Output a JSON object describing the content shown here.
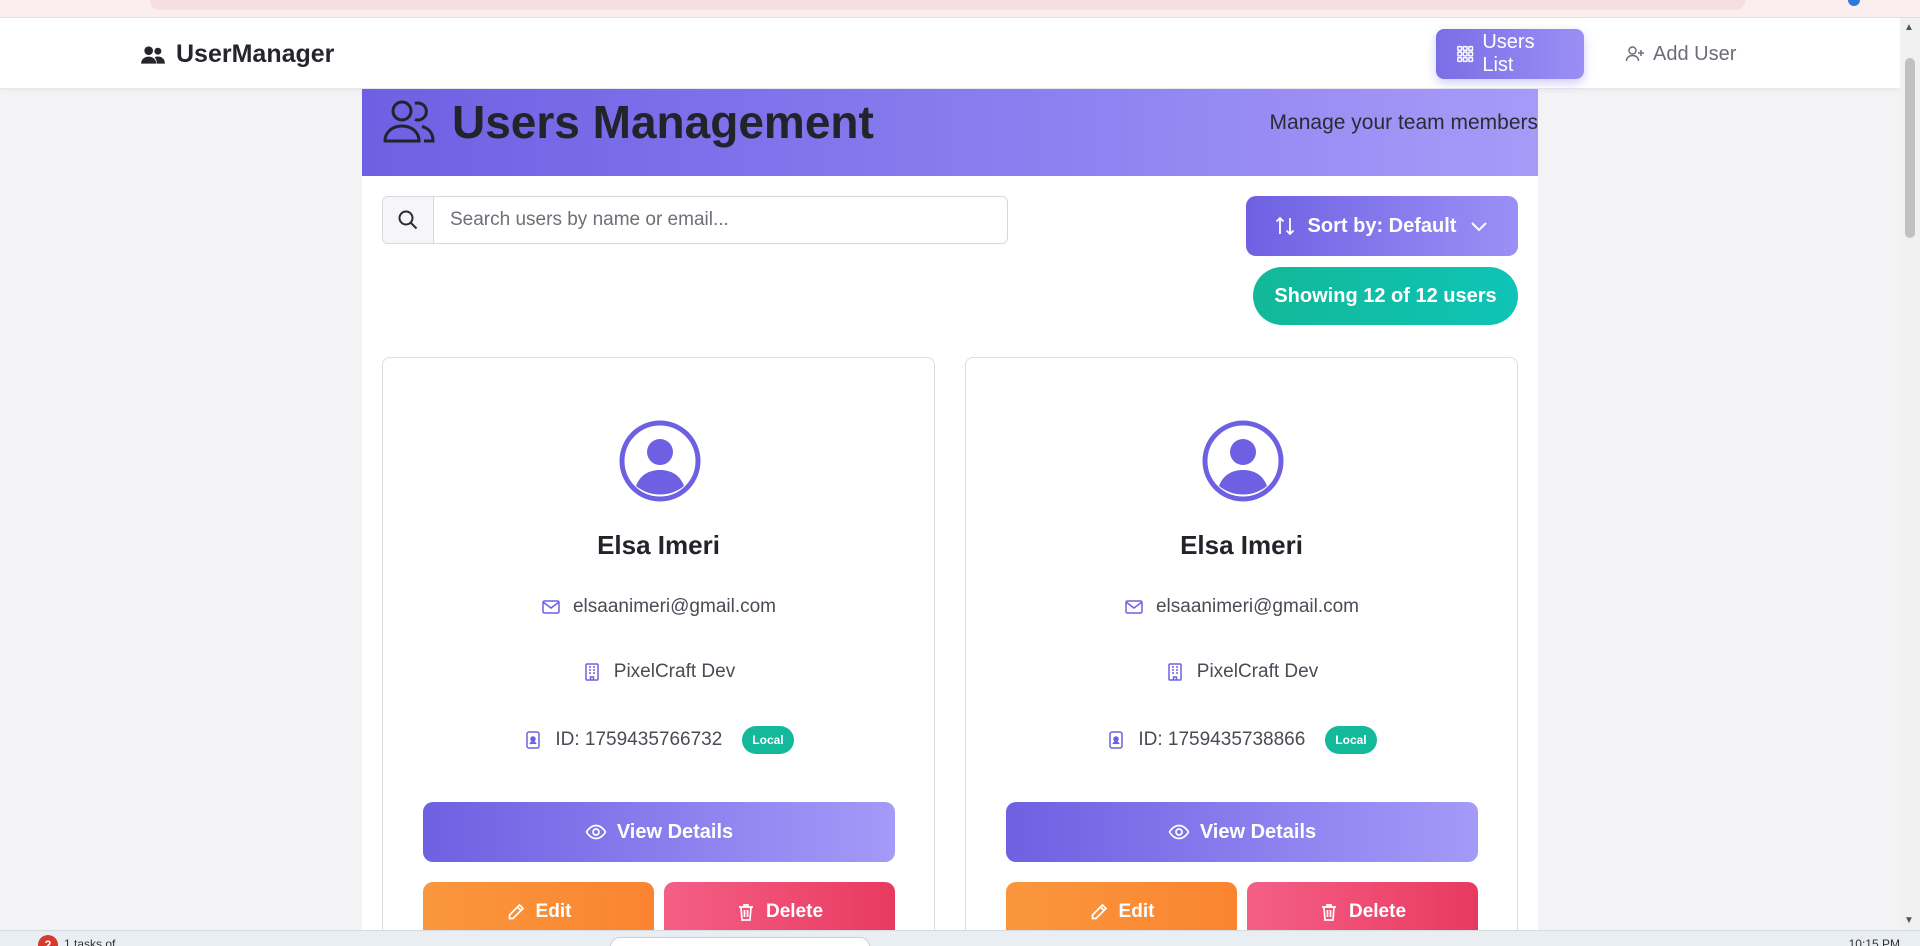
{
  "navbar": {
    "brand": "UserManager",
    "users_list": "Users List",
    "add_user": "Add User"
  },
  "header": {
    "title": "Users Management",
    "subtitle": "Manage your team members"
  },
  "search": {
    "placeholder": "Search users by name or email..."
  },
  "sort": {
    "label": "Sort by: Default"
  },
  "count": {
    "label": "Showing 12 of 12 users"
  },
  "cards": [
    {
      "name": "Elsa Imeri",
      "email": "elsaanimeri@gmail.com",
      "company": "PixelCraft Dev",
      "id": "ID: 1759435766732",
      "badge": "Local",
      "view": "View Details",
      "edit": "Edit",
      "delete": "Delete"
    },
    {
      "name": "Elsa Imeri",
      "email": "elsaanimeri@gmail.com",
      "company": "PixelCraft Dev",
      "id": "ID: 1759435738866",
      "badge": "Local",
      "view": "View Details",
      "edit": "Edit",
      "delete": "Delete"
    }
  ],
  "taskbar": {
    "notification_count": "2",
    "notification_text": "1 tasks of...",
    "time": "10:15 PM"
  },
  "colors": {
    "accent": "#6e60e2",
    "teal": "#12b898",
    "orange": "#fb8430",
    "red": "#e83a60"
  }
}
